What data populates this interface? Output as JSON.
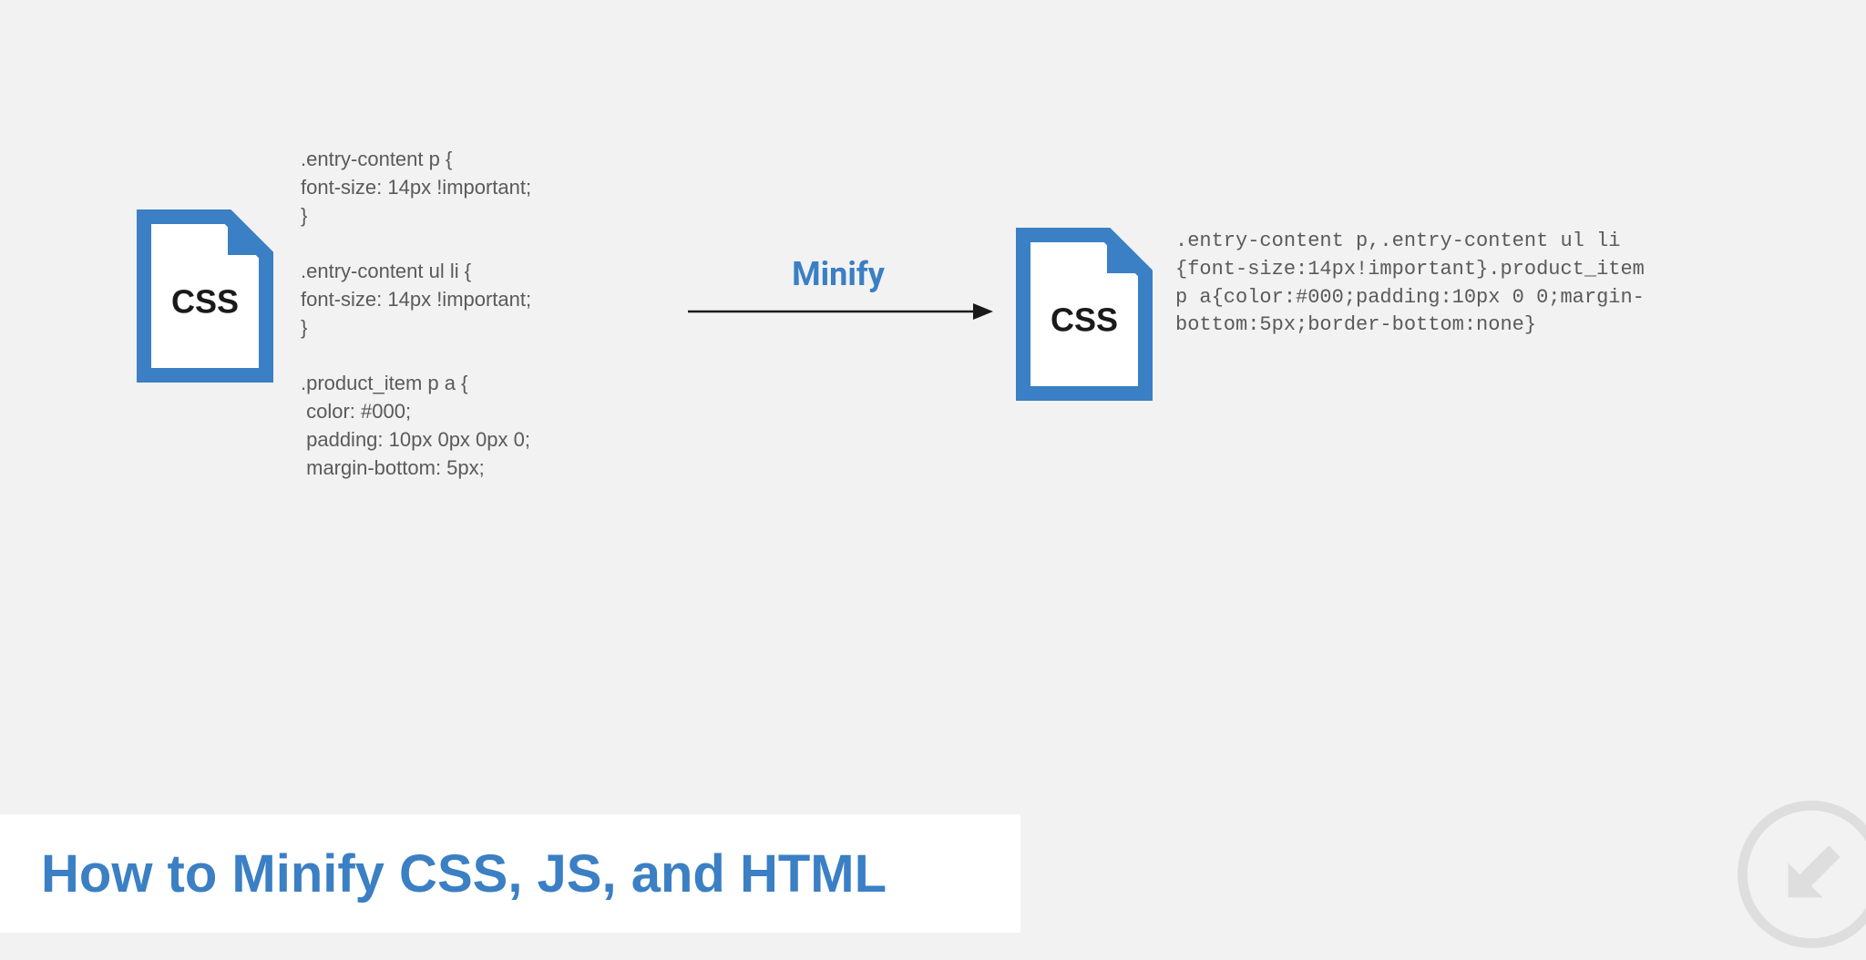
{
  "diagram": {
    "left_file_label": "CSS",
    "right_file_label": "CSS",
    "arrow_label": "Minify",
    "css_before": ".entry-content p {\nfont-size: 14px !important;\n}\n\n.entry-content ul li {\nfont-size: 14px !important;\n}\n\n.product_item p a {\n color: #000;\n padding: 10px 0px 0px 0;\n margin-bottom: 5px;",
    "css_after": ".entry-content p,.entry-content ul li\n{font-size:14px!important}.product_item\np a{color:#000;padding:10px 0 0;margin-\nbottom:5px;border-bottom:none}"
  },
  "title": "How to Minify CSS, JS, and HTML",
  "colors": {
    "accent": "#3b7fc4",
    "file_icon": "#3b7fc4",
    "text": "#5a5a5a",
    "background": "#f2f2f2"
  }
}
